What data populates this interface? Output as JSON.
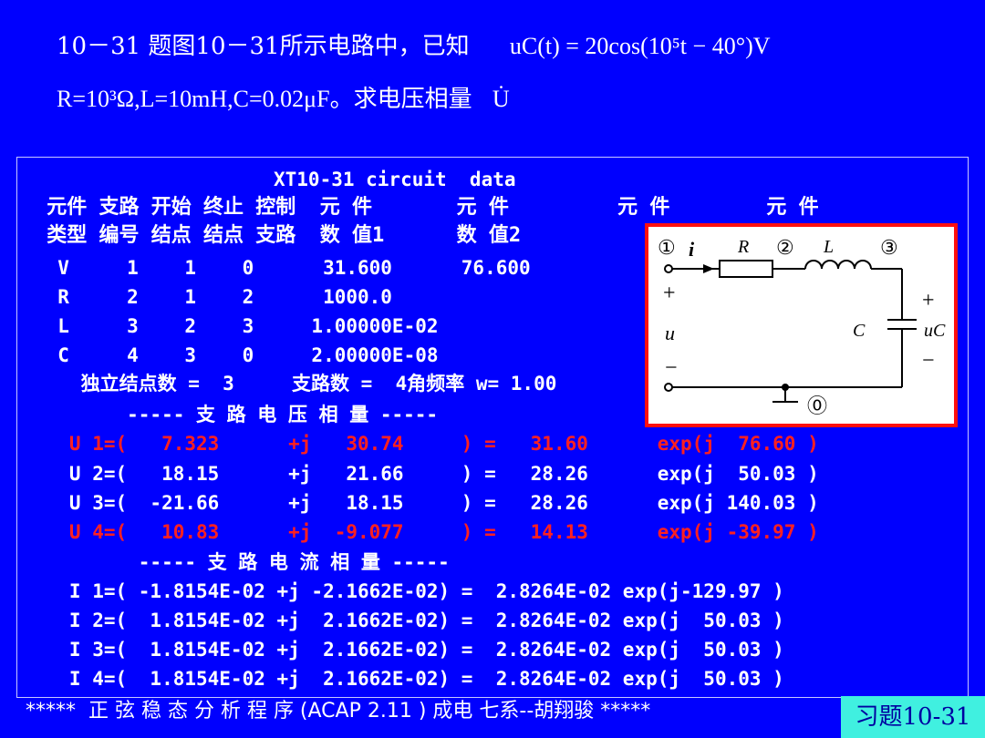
{
  "question": {
    "line1_prefix": "10－31 题图10－31所示电路中，已知",
    "line1_formula": "uC(t) = 20cos(10⁵t − 40°)V",
    "line2_params": "R=10³Ω,L=10mH,C=0.02μF。求电压相量",
    "line2_symbol": "U̇"
  },
  "panel": {
    "title": "XT10-31 circuit  data",
    "header1": " 元件 支路 开始 终止 控制  元 件       元 件         元 件        元 件",
    "header2": " 类型 编号 结点 结点 支路  数 值1      数 值2",
    "rows": [
      "  V     1    1    0      31.600      76.600",
      "  R     2    1    2      1000.0",
      "  L     3    2    3     1.00000E-02",
      "  C     4    3    0     2.00000E-08"
    ],
    "summary": "    独立结点数 =  3     支路数 =  4角频率 w= 1.00",
    "voltage_heading": "        ----- 支 路 电 压 相 量 -----",
    "voltages": [
      {
        "text": "   U 1=(   7.323      +j   30.74     ) =   31.60      exp(j  76.60 )",
        "color": "red"
      },
      {
        "text": "   U 2=(   18.15      +j   21.66     ) =   28.26      exp(j  50.03 )",
        "color": "white"
      },
      {
        "text": "   U 3=(  -21.66      +j   18.15     ) =   28.26      exp(j 140.03 )",
        "color": "white"
      },
      {
        "text": "   U 4=(   10.83      +j  -9.077     ) =   14.13      exp(j -39.97 )",
        "color": "red"
      }
    ],
    "current_heading": "         ----- 支 路 电 流 相 量 -----",
    "currents": [
      "   I 1=( -1.8154E-02 +j -2.1662E-02) =  2.8264E-02 exp(j-129.97 )",
      "   I 2=(  1.8154E-02 +j  2.1662E-02) =  2.8264E-02 exp(j  50.03 )",
      "   I 3=(  1.8154E-02 +j  2.1662E-02) =  2.8264E-02 exp(j  50.03 )",
      "   I 4=(  1.8154E-02 +j  2.1662E-02) =  2.8264E-02 exp(j  50.03 )"
    ]
  },
  "circuit": {
    "node1": "①",
    "node2": "②",
    "node3": "③",
    "node0": "⓪",
    "i_label": "i",
    "R_label": "R",
    "L_label": "L",
    "C_label": "C",
    "u_label": "u",
    "uc_label": "uC",
    "plus": "+",
    "minus": "−"
  },
  "footer": "*****  正 弦 稳 态 分 析 程 序 (ACAP 2.11 ) 成电 七系--胡翔骏 *****",
  "tag": "习题10-31",
  "colors": {
    "background": "#0000fe",
    "highlight": "#ff2020",
    "tag_bg": "#40f0e0"
  }
}
